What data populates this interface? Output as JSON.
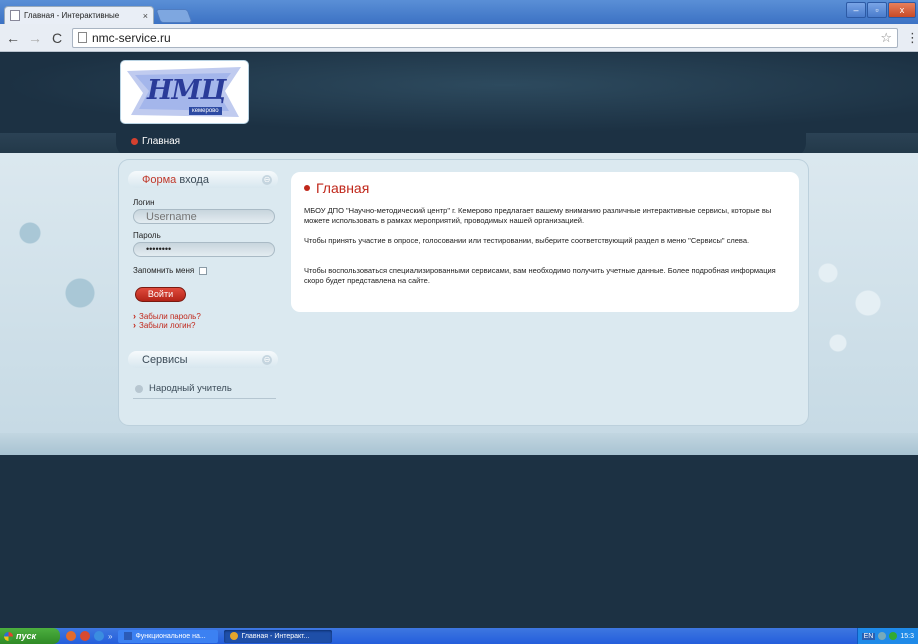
{
  "browser": {
    "tab_title": "Главная - Интерактивные",
    "tab_close": "×",
    "url": "nmc-service.ru",
    "back": "←",
    "forward": "→",
    "reload": "C",
    "star": "☆",
    "menu": "⋮",
    "win_min": "–",
    "win_max": "▫",
    "win_close": "x"
  },
  "site": {
    "logo_text": "НМЦ",
    "logo_sub": "кемерово",
    "nav": {
      "home": "Главная"
    }
  },
  "login_module": {
    "title_red": "Форма",
    "title_rest": " входа",
    "collapse_icon": "⊖",
    "login_label": "Логин",
    "login_placeholder": "Username",
    "password_label": "Пароль",
    "password_value": "••••••••",
    "remember_label": "Запомнить меня",
    "submit_label": "Войти",
    "forgot_password": "Забыли пароль?",
    "forgot_login": "Забыли логин?"
  },
  "services_module": {
    "title": "Сервисы",
    "collapse_icon": "⊖",
    "items": [
      {
        "label": "Народный учитель"
      }
    ]
  },
  "article": {
    "title": "Главная",
    "paragraphs": [
      "МБОУ ДПО \"Научно-методический центр\" г. Кемерово предлагает вашему вниманию различные интерактивные сервисы, которые вы можете использовать в рамках мероприятий, проводимых нашей организацией.",
      "Чтобы принять участие в опросе, голосовании или тестировании, выберите соответствующий раздел в меню \"Сервисы\" слева.",
      "Чтобы воспользоваться специализированными сервисами, вам необходимо получить учетные данные. Более подробная информация скоро будет представлена на сайте."
    ]
  },
  "taskbar": {
    "start_label": "пуск",
    "quick_more": "»",
    "tasks": [
      {
        "label": "Функциональное на...",
        "active": false
      },
      {
        "label": "Главная - Интеракт...",
        "active": true
      }
    ],
    "tray_lang": "EN",
    "clock": "15:3"
  },
  "colors": {
    "accent_red": "#c0271a",
    "page_dark": "#1c3143",
    "panel": "#dbe9f0"
  }
}
